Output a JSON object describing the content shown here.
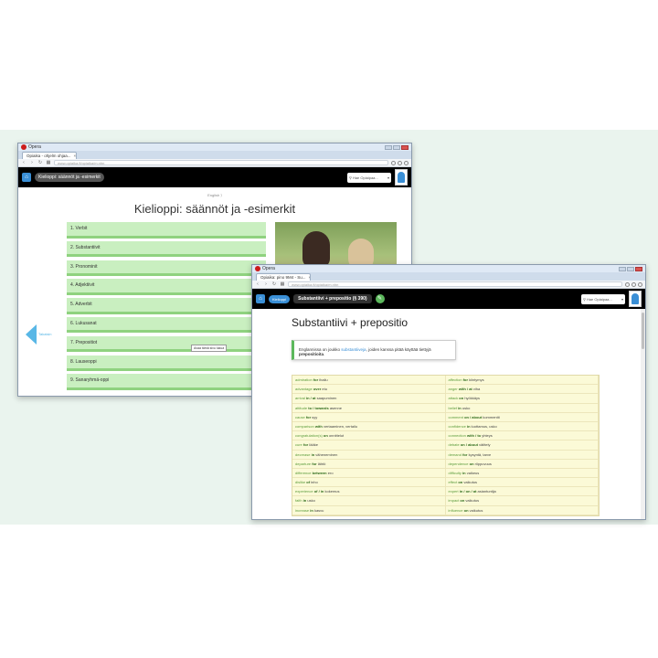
{
  "window1": {
    "title": "Opera",
    "tab": "Opiaika - ohjelm ohjaa...",
    "url": "www.opiaika.fi/opiaika/m.nhn",
    "breadcrumb": "Kielioppi: säännöt ja -esimerkit",
    "search_placeholder": "Hae Opiaipaa...",
    "subtitle": "English ⟩",
    "heading": "Kielioppi: säännöt ja -esimerkit",
    "back_label": "Takaisin",
    "menu": [
      "1. Verbit",
      "2. Substantiivit",
      "3. Pronominit",
      "4. Adjektiivit",
      "5. Adverbit",
      "6. Lukusanat",
      "7. Prepositiot",
      "8. Lauseoppi",
      "9. Sanaryhmä-oppi"
    ],
    "tooltip": "Avaa tämä sivu lukua"
  },
  "window2": {
    "title": "Opera",
    "tab": "Opiaika: pino 9M4 - Su...",
    "url": "www.opiaika.fi/opiaika/m.nhn",
    "crumb_small": "Kielioppi",
    "breadcrumb": "Substantiivi + prepositio (§ 390)",
    "search_placeholder": "Hae Opiaipaa...",
    "heading": "Substantiivi + prepositio",
    "note_pre": "Englannissa on joukko ",
    "note_link": "substantiiveja",
    "note_mid": ", joiden kanssa pitää käyttää tiettyjä ",
    "note_bold": "prepositioita",
    "note_end": ".",
    "rows": [
      {
        "l1": "admiration",
        "p1": "for",
        "f1": "ihailu",
        "l2": "affection",
        "p2": "for",
        "f2": "kiintymys"
      },
      {
        "l1": "advantage",
        "p1": "over",
        "f1": "etu",
        "l2": "anger",
        "p2": "with / at",
        "f2": "viha"
      },
      {
        "l1": "arrival",
        "p1": "in / at",
        "f1": "saapuminen",
        "l2": "attack",
        "p2": "on",
        "f2": "hyökkäys"
      },
      {
        "l1": "attitude",
        "p1": "to / towards",
        "f1": "asenne",
        "l2": "belief",
        "p2": "in",
        "f2": "usko"
      },
      {
        "l1": "cause",
        "p1": "for",
        "f1": "syy",
        "l2": "comment",
        "p2": "on / about",
        "f2": "kommentti"
      },
      {
        "l1": "comparison",
        "p1": "with",
        "f1": "vertaaminen, vertailu",
        "l2": "confidence",
        "p2": "in",
        "f2": "luottamus, usko"
      },
      {
        "l1": "congratulation(s)",
        "p1": "on",
        "f1": "onnittelut",
        "l2": "connection",
        "p2": "with / to",
        "f2": "yhteys"
      },
      {
        "l1": "cure",
        "p1": "for",
        "f1": "lääke",
        "l2": "debate",
        "p2": "on / about",
        "f2": "väittely"
      },
      {
        "l1": "decrease",
        "p1": "in",
        "f1": "väheneminen",
        "l2": "demand",
        "p2": "for",
        "f2": "kysyntä, tarve"
      },
      {
        "l1": "departure",
        "p1": "for",
        "f1": "lähtö",
        "l2": "dependence",
        "p2": "on",
        "f2": "riippuvuus"
      },
      {
        "l1": "difference",
        "p1": "between",
        "f1": "ero",
        "l2": "difficulty",
        "p2": "in",
        "f2": "vaikeus"
      },
      {
        "l1": "dislike",
        "p1": "of",
        "f1": "inho",
        "l2": "effect",
        "p2": "on",
        "f2": "vaikutus"
      },
      {
        "l1": "experience",
        "p1": "of / in",
        "f1": "kokemus",
        "l2": "expert",
        "p2": "in / on / at",
        "f2": "asiantuntija"
      },
      {
        "l1": "faith",
        "p1": "in",
        "f1": "usko",
        "l2": "impact",
        "p2": "on",
        "f2": "vaikutus"
      },
      {
        "l1": "increase",
        "p1": "in",
        "f1": "kasvu",
        "l2": "influence",
        "p2": "on",
        "f2": "vaikutus"
      }
    ]
  }
}
